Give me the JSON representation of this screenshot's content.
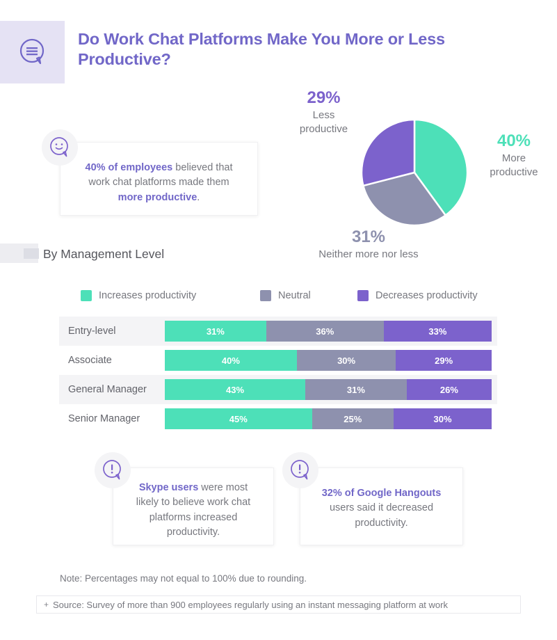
{
  "header": {
    "title": "Do Work Chat Platforms Make You More or Less Productive?",
    "icon": "speech-bubble-lines-icon"
  },
  "pie_labels": {
    "less": {
      "value": "29%",
      "caption": "Less\nproductive"
    },
    "more": {
      "value": "40%",
      "caption": "More\nproductive"
    },
    "neither": {
      "value": "31%",
      "caption": "Neither more nor less"
    }
  },
  "callouts": {
    "top": {
      "icon": "smiley-speech-bubble-icon",
      "segments": [
        {
          "text": "40% of employees",
          "bold": true
        },
        {
          "text": " believed that work chat platforms made them ",
          "bold": false
        },
        {
          "text": "more productive",
          "bold": true
        },
        {
          "text": ".",
          "bold": false
        }
      ]
    },
    "bottom_left": {
      "icon": "exclamation-speech-bubble-icon",
      "segments": [
        {
          "text": "Skype users",
          "bold": true
        },
        {
          "text": " were most likely to believe work chat platforms increased productivity.",
          "bold": false
        }
      ]
    },
    "bottom_right": {
      "icon": "exclamation-speech-bubble-icon",
      "segments": [
        {
          "text": "32% of Google Hangouts",
          "bold": true
        },
        {
          "text": " users said it decreased productivity.",
          "bold": false
        }
      ]
    }
  },
  "section": {
    "title": "By Management Level"
  },
  "legend": [
    {
      "label": "Increases productivity",
      "color": "#4de0b8"
    },
    {
      "label": "Neutral",
      "color": "#8e91ae"
    },
    {
      "label": "Decreases productivity",
      "color": "#7c62cc"
    }
  ],
  "footer": {
    "note": "Note: Percentages may not equal to 100% due to rounding.",
    "source_plus": "+",
    "source": "Source: Survey of more than 900 employees regularly using an instant messaging platform at work"
  },
  "colors": {
    "teal": "#4de0b8",
    "gray": "#8e91ae",
    "purple": "#7c62cc",
    "title_purple": "#7167c8",
    "header_bg": "#e5e2f4",
    "row_shade": "#f4f4f6"
  },
  "chart_data": [
    {
      "type": "pie",
      "title": "Do Work Chat Platforms Make You More or Less Productive?",
      "categories": [
        "More productive",
        "Neither more nor less",
        "Less productive"
      ],
      "values": [
        40,
        31,
        29
      ],
      "colors": [
        "#4de0b8",
        "#8e91ae",
        "#7c62cc"
      ],
      "labels": [
        "40%",
        "31%",
        "29%"
      ],
      "legend": "outside-labels",
      "start_angle_deg": 0,
      "direction": "clockwise"
    },
    {
      "type": "bar",
      "subtype": "stacked-horizontal-100",
      "title": "By Management Level",
      "categories": [
        "Entry-level",
        "Associate",
        "General Manager",
        "Senior Manager"
      ],
      "series": [
        {
          "name": "Increases productivity",
          "color": "#4de0b8",
          "values": [
            31,
            40,
            43,
            45
          ]
        },
        {
          "name": "Neutral",
          "color": "#8e91ae",
          "values": [
            36,
            30,
            31,
            25
          ]
        },
        {
          "name": "Decreases productivity",
          "color": "#7c62cc",
          "values": [
            33,
            29,
            26,
            30
          ]
        }
      ],
      "value_labels": [
        [
          "31%",
          "36%",
          "33%"
        ],
        [
          "40%",
          "30%",
          "29%"
        ],
        [
          "43%",
          "31%",
          "26%"
        ],
        [
          "45%",
          "25%",
          "30%"
        ]
      ],
      "xlabel": "",
      "ylabel": "",
      "xlim": [
        0,
        100
      ],
      "grid": false
    }
  ]
}
